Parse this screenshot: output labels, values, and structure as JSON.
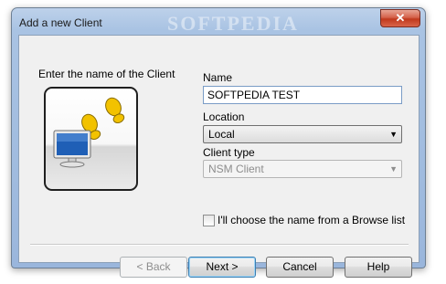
{
  "window": {
    "title": "Add a new Client",
    "watermark": "SOFTPEDIA",
    "close_symbol": "✕"
  },
  "form": {
    "intro": "Enter the name of the Client",
    "name_label": "Name",
    "name_value": "SOFTPEDIA TEST",
    "location_label": "Location",
    "location_value": "Local",
    "client_type_label": "Client type",
    "client_type_value": "NSM Client",
    "browse_checkbox_label": "I'll choose the name from a Browse list",
    "browse_checked": false
  },
  "buttons": {
    "back": "< Back",
    "next": "Next >",
    "cancel": "Cancel",
    "help": "Help"
  },
  "icons": {
    "illustration": "computer-with-footprints-icon",
    "dropdown": "chevron-down-icon",
    "close": "close-icon"
  },
  "colors": {
    "footprints": "#f2c200",
    "monitor_screen": "#1f5fb6",
    "close_button": "#c0391d"
  }
}
